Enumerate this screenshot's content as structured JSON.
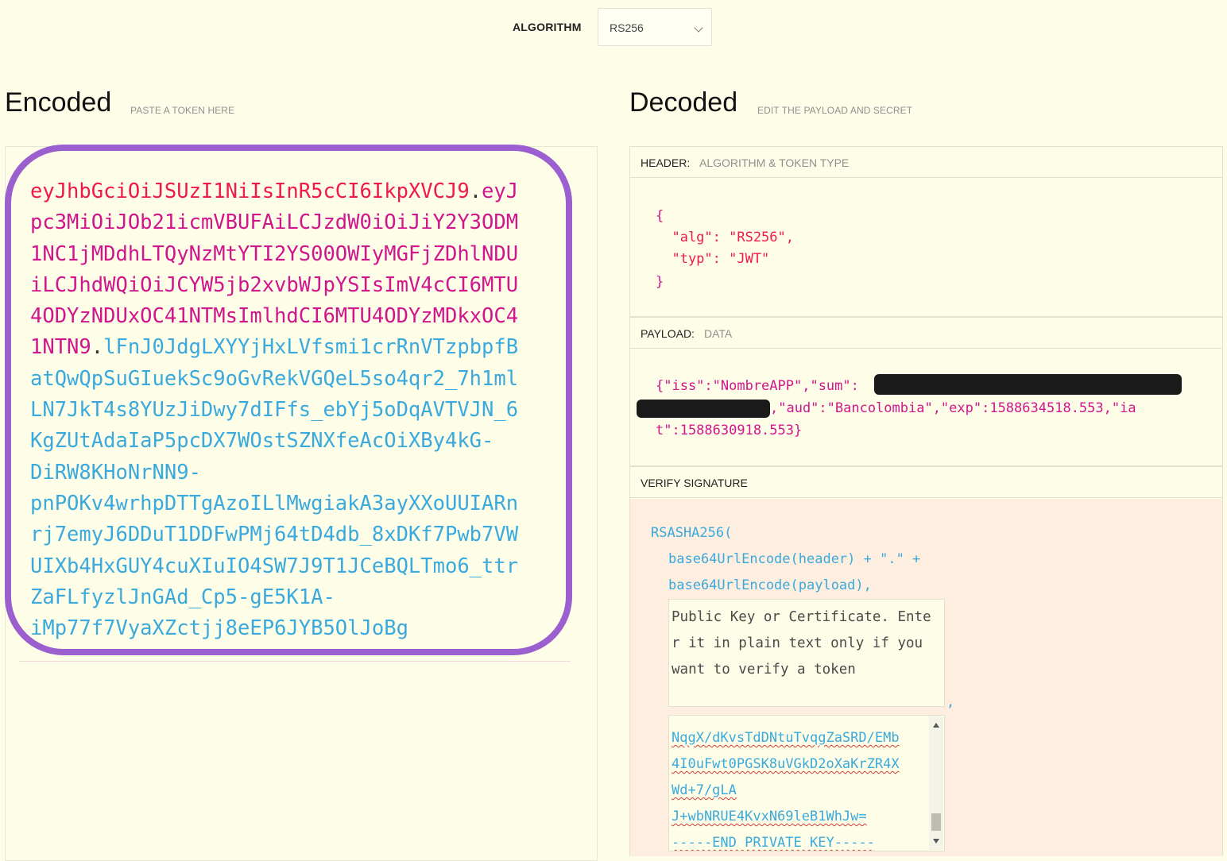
{
  "algorithm": {
    "label": "ALGORITHM",
    "value": "RS256"
  },
  "encoded": {
    "title": "Encoded",
    "subtitle": "PASTE A TOKEN HERE",
    "lines": [
      [
        {
          "t": "eyJhbGciOiJSUzI1NiIsInR5cCI6IkpXVCJ9",
          "c": "red"
        },
        {
          "t": ".",
          "c": "dot"
        },
        {
          "t": "eyJ",
          "c": "pink"
        }
      ],
      [
        {
          "t": "pc3MiOiJOb21icmVBUFAiLCJzdW0iOiJiY2Y3ODM",
          "c": "pink"
        }
      ],
      [
        {
          "t": "1NC1jMDdhLTQyNzMtYTI2YS00OWIyMGFjZDhlNDU",
          "c": "pink"
        }
      ],
      [
        {
          "t": "iLCJhdWQiOiJCYW5jb2xvbWJpYSIsImV4cCI6MTU",
          "c": "pink"
        }
      ],
      [
        {
          "t": "4ODYzNDUxOC41NTMsImlhdCI6MTU4ODYzMDkxOC4",
          "c": "pink"
        }
      ],
      [
        {
          "t": "1NTN9",
          "c": "pink"
        },
        {
          "t": ".",
          "c": "dot"
        },
        {
          "t": "lFnJ0JdgLXYYjHxLVfsmi1crRnVTzpbpfB",
          "c": "blue"
        }
      ],
      [
        {
          "t": "atQwQpSuGIuekSc9oGvRekVGQeL5so4qr2_7h1ml",
          "c": "blue"
        }
      ],
      [
        {
          "t": "LN7JkT4s8YUzJiDwy7dIFfs_ebYj5oDqAVTVJN_6",
          "c": "blue"
        }
      ],
      [
        {
          "t": "KgZUtAdaIaP5pcDX7WOstSZNXfeAcOiXBy4kG-",
          "c": "blue"
        }
      ],
      [
        {
          "t": "DiRW8KHoNrNN9-",
          "c": "blue"
        }
      ],
      [
        {
          "t": "pnPOKv4wrhpDTTgAzoILlMwgiakA3ayXXoUUIARn",
          "c": "blue"
        }
      ],
      [
        {
          "t": "rj7emyJ6DDuT1DDFwPMj64tD4db_8xDKf7Pwb7VW",
          "c": "blue"
        }
      ],
      [
        {
          "t": "UIXb4HxGUY4cuXIuIO4SW7J9T1JCeBQLTmo6_ttr",
          "c": "blue"
        }
      ],
      [
        {
          "t": "ZaFLfyzlJnGAd_Cp5-gE5K1A-",
          "c": "blue"
        }
      ],
      [
        {
          "t": "iMp77f7VyaXZctjj8eEP6JYB5OlJoBg",
          "c": "blue"
        }
      ]
    ]
  },
  "decoded": {
    "title": "Decoded",
    "subtitle": "EDIT THE PAYLOAD AND SECRET",
    "header": {
      "key": "HEADER:",
      "desc": "ALGORITHM & TOKEN TYPE",
      "open": "{",
      "alg_line": "  \"alg\": \"RS256\",",
      "typ_line": "  \"typ\": \"JWT\"",
      "close": "}"
    },
    "payload": {
      "key": "PAYLOAD:",
      "desc": "DATA",
      "line1": "{\"iss\":\"NombreAPP\",\"sum\":",
      "line2": ",\"aud\":\"Bancolombia\",\"exp\":1588634518.553,\"ia",
      "line3": "t\":1588630918.553}"
    },
    "verify": {
      "title": "VERIFY SIGNATURE",
      "fn": "RSASHA256(",
      "arg1": "base64UrlEncode(header) + \".\" +",
      "arg2": "base64UrlEncode(payload),",
      "public_key_placeholder": "Public Key or Certificate. Enter it in plain text only if you want to verify a token",
      "comma": ",",
      "private_lines": [
        "NqgX/dKvsTdDNtuTvqgZaSRD/EMb",
        "4I0uFwt0PGSK8uVGkD2oXaKrZR4X",
        "Wd+7/gLA",
        "J+wbNRUE4KvxN69leB1WhJw=",
        "-----END PRIVATE KEY-----"
      ]
    }
  },
  "colors": {
    "accent": "#9b5fcf",
    "header_red": "#f0194d",
    "payload_pink": "#d1158d",
    "signature_blue": "#3aa9dd"
  }
}
